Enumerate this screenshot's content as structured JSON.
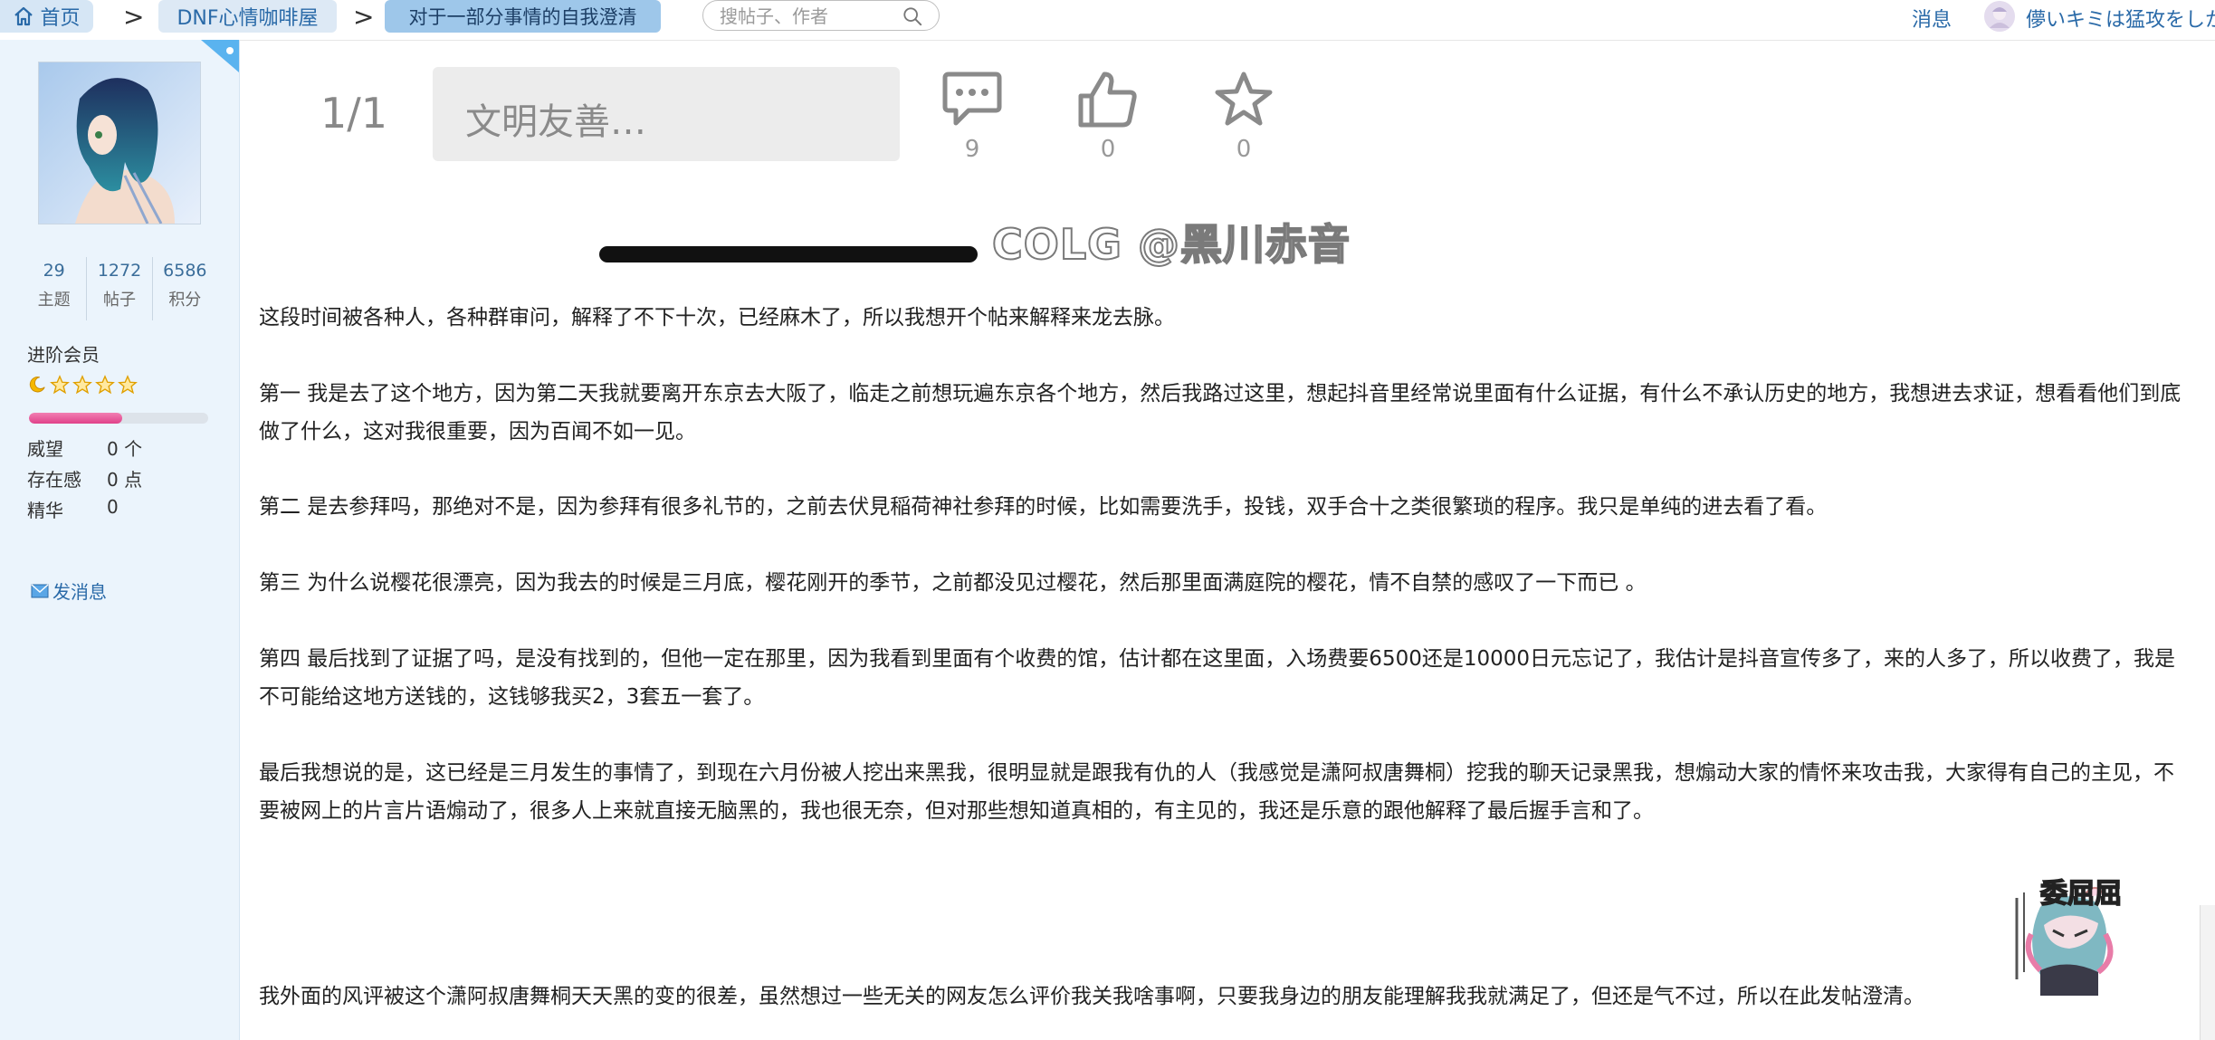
{
  "breadcrumb": {
    "home": "首页",
    "forum": "DNF心情咖啡屋",
    "thread": "对于一部分事情的自我澄清"
  },
  "search": {
    "placeholder": "搜帖子、作者"
  },
  "header": {
    "messages": "消息",
    "username": "儚いキミは猛攻をしかけ"
  },
  "profile": {
    "stats": [
      {
        "value": "29",
        "label": "主题"
      },
      {
        "value": "1272",
        "label": "帖子"
      },
      {
        "value": "6586",
        "label": "积分"
      }
    ],
    "rank": "进阶会员",
    "progress": 0.52,
    "fields": [
      {
        "key": "威望",
        "value": "0 个"
      },
      {
        "key": "存在感",
        "value": "0 点"
      },
      {
        "key": "精华",
        "value": "0"
      }
    ],
    "send_message": "发消息"
  },
  "toolbar": {
    "page": "1/1",
    "reply_placeholder": "文明友善…",
    "comments": "9",
    "likes": "0",
    "favorites": "0"
  },
  "watermark": "COLG @黑川赤音",
  "post": {
    "p1": "这段时间被各种人，各种群审问，解释了不下十次，已经麻木了，所以我想开个帖来解释来龙去脉。",
    "p2": "第一 我是去了这个地方，因为第二天我就要离开东京去大阪了，临走之前想玩遍东京各个地方，然后我路过这里，想起抖音里经常说里面有什么证据，有什么不承认历史的地方，我想进去求证，想看看他们到底做了什么，这对我很重要，因为百闻不如一见。",
    "p3": "第二 是去参拜吗，那绝对不是，因为参拜有很多礼节的，之前去伏見稲荷神社参拜的时候，比如需要洗手，投钱，双手合十之类很繁琐的程序。我只是单纯的进去看了看。",
    "p4": "第三 为什么说樱花很漂亮，因为我去的时候是三月底，樱花刚开的季节，之前都没见过樱花，然后那里面满庭院的樱花，情不自禁的感叹了一下而已 。",
    "p5": "第四 最后找到了证据了吗，是没有找到的，但他一定在那里，因为我看到里面有个收费的馆，估计都在这里面，入场费要6500还是10000日元忘记了，我估计是抖音宣传多了，来的人多了，所以收费了，我是不可能给这地方送钱的，这钱够我买2，3套五一套了。",
    "p6": "最后我想说的是，这已经是三月发生的事情了，到现在六月份被人挖出来黑我，很明显就是跟我有仇的人（我感觉是潇阿叔唐舞桐）挖我的聊天记录黑我，想煽动大家的情怀来攻击我，大家得有自己的主见，不要被网上的片言片语煽动了，很多人上来就直接无脑黑的，我也很无奈，但对那些想知道真相的，有主见的，我还是乐意的跟他解释了最后握手言和了。",
    "p7": "我外面的风评被这个潇阿叔唐舞桐天天黑的变的很差，虽然想过一些无关的网友怎么评价我关我啥事啊，只要我身边的朋友能理解我我就满足了，但还是气不过，所以在此发帖澄清。"
  },
  "sticker_text": "委屈屈",
  "colors": {
    "accent": "#2a6aa8",
    "sidebar_bg": "#ebf4fc",
    "progress": "#e0418a",
    "star": "#f5b800"
  }
}
